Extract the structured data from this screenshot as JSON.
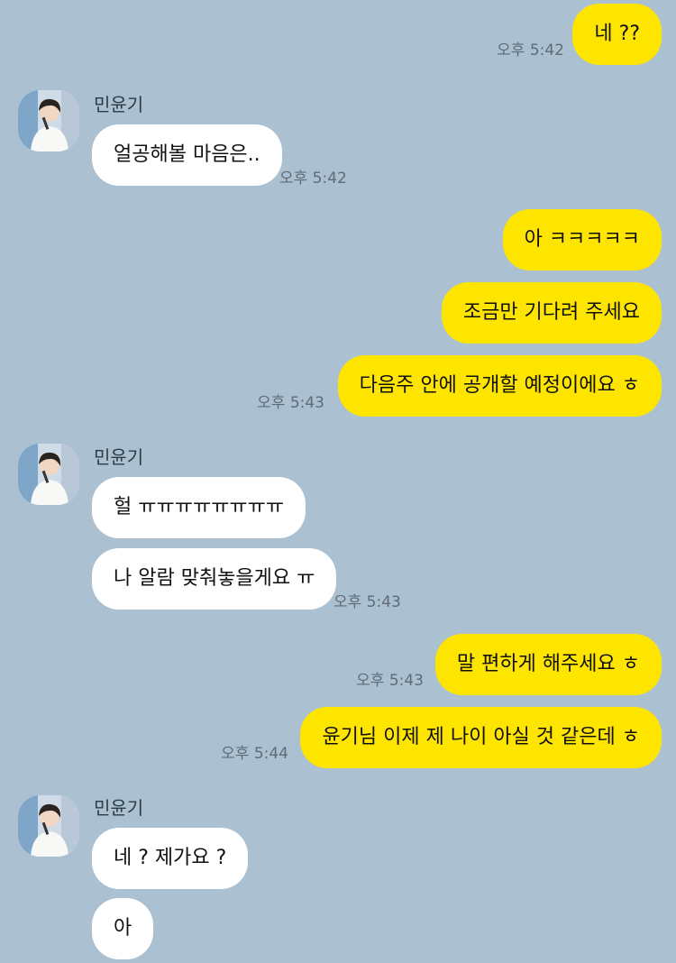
{
  "chat": {
    "sender_name": "민윤기",
    "messages": [
      {
        "from": "me",
        "text": "네 ??",
        "time": "오후 5:42"
      },
      {
        "from": "other",
        "text": "얼공해볼 마음은..",
        "time": "오후 5:42"
      },
      {
        "from": "me",
        "text": "아 ㅋㅋㅋㅋㅋ",
        "time": ""
      },
      {
        "from": "me",
        "text": "조금만 기다려 주세요",
        "time": ""
      },
      {
        "from": "me",
        "text": "다음주 안에 공개할 예정이에요 ㅎ",
        "time": "오후 5:43"
      },
      {
        "from": "other",
        "text": "헐 ㅠㅠㅠㅠㅠㅠㅠㅠ",
        "time": ""
      },
      {
        "from": "other",
        "text": "나 알람 맞춰놓을게요 ㅠ",
        "time": "오후 5:43"
      },
      {
        "from": "me",
        "text": "말 편하게 해주세요 ㅎ",
        "time": "오후 5:43"
      },
      {
        "from": "me",
        "text": "윤기님 이제 제 나이 아실 것 같은데 ㅎ",
        "time": "오후 5:44"
      },
      {
        "from": "other",
        "text": "네 ? 제가요 ?",
        "time": ""
      },
      {
        "from": "other",
        "text": "아",
        "time": ""
      }
    ]
  },
  "colors": {
    "background": "#abc1d1",
    "my_bubble": "#fee500",
    "other_bubble": "#ffffff",
    "time_text": "#5f6b76"
  },
  "icons": {
    "avatar": "profile-photo"
  }
}
